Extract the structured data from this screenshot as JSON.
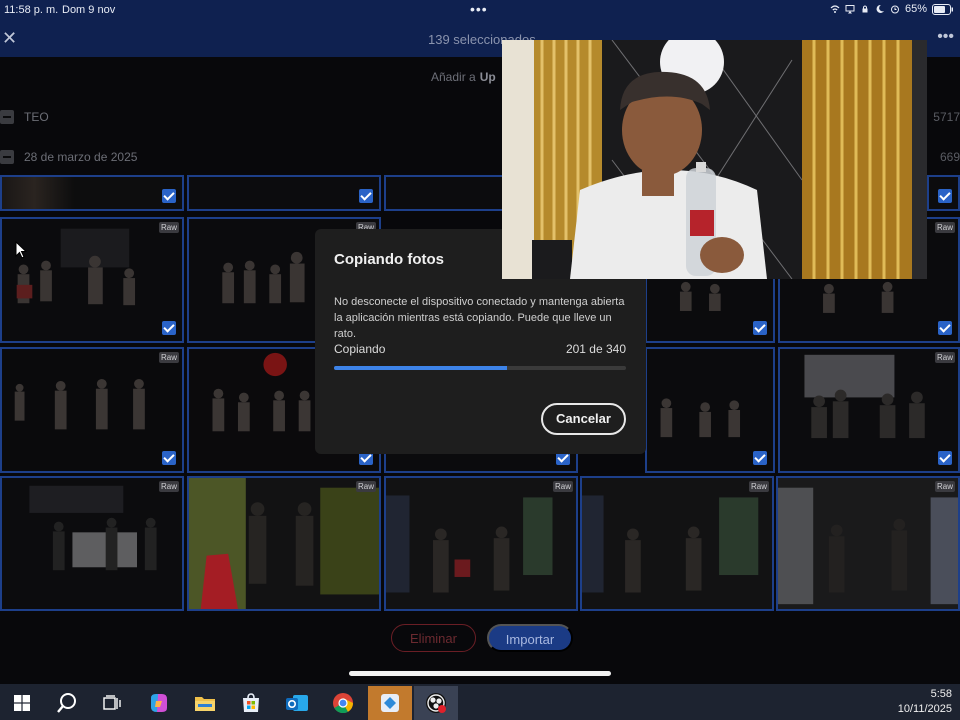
{
  "status_bar": {
    "time": "11:58 p. m.",
    "date": "Dom 9 nov",
    "battery": "65%"
  },
  "app_header": {
    "title": "139 seleccionados"
  },
  "toolbar": {
    "add_to": "Añadir a",
    "add_to_target": "Up"
  },
  "groups": [
    {
      "label": "TEO",
      "count": "5717"
    },
    {
      "label": "28 de marzo de 2025",
      "count": "669"
    }
  ],
  "tile_badge": "Raw",
  "actions": {
    "delete": "Eliminar",
    "import": "Importar"
  },
  "dialog": {
    "title": "Copiando fotos",
    "message": "No desconecte el dispositivo conectado y mantenga abierta la aplicación mientras está copiando. Puede que lleve un rato.",
    "progress_label": "Copiando",
    "progress_text": "201 de 340",
    "progress_fraction": 0.591,
    "cancel": "Cancelar"
  },
  "taskbar": {
    "icons": [
      "windows-start-icon",
      "search-icon",
      "task-view-icon",
      "copilot-icon",
      "file-explorer-icon",
      "microsoft-store-icon",
      "outlook-icon",
      "chrome-icon",
      "remote-app-icon",
      "obs-icon"
    ],
    "time": "5:58",
    "date": "10/11/2025"
  },
  "colors": {
    "header_bg": "#0f2150",
    "selection_border": "#1d3f8a",
    "check": "#2a63c7",
    "progress": "#3d83e8",
    "dialog_bg": "#1e1e1e"
  }
}
